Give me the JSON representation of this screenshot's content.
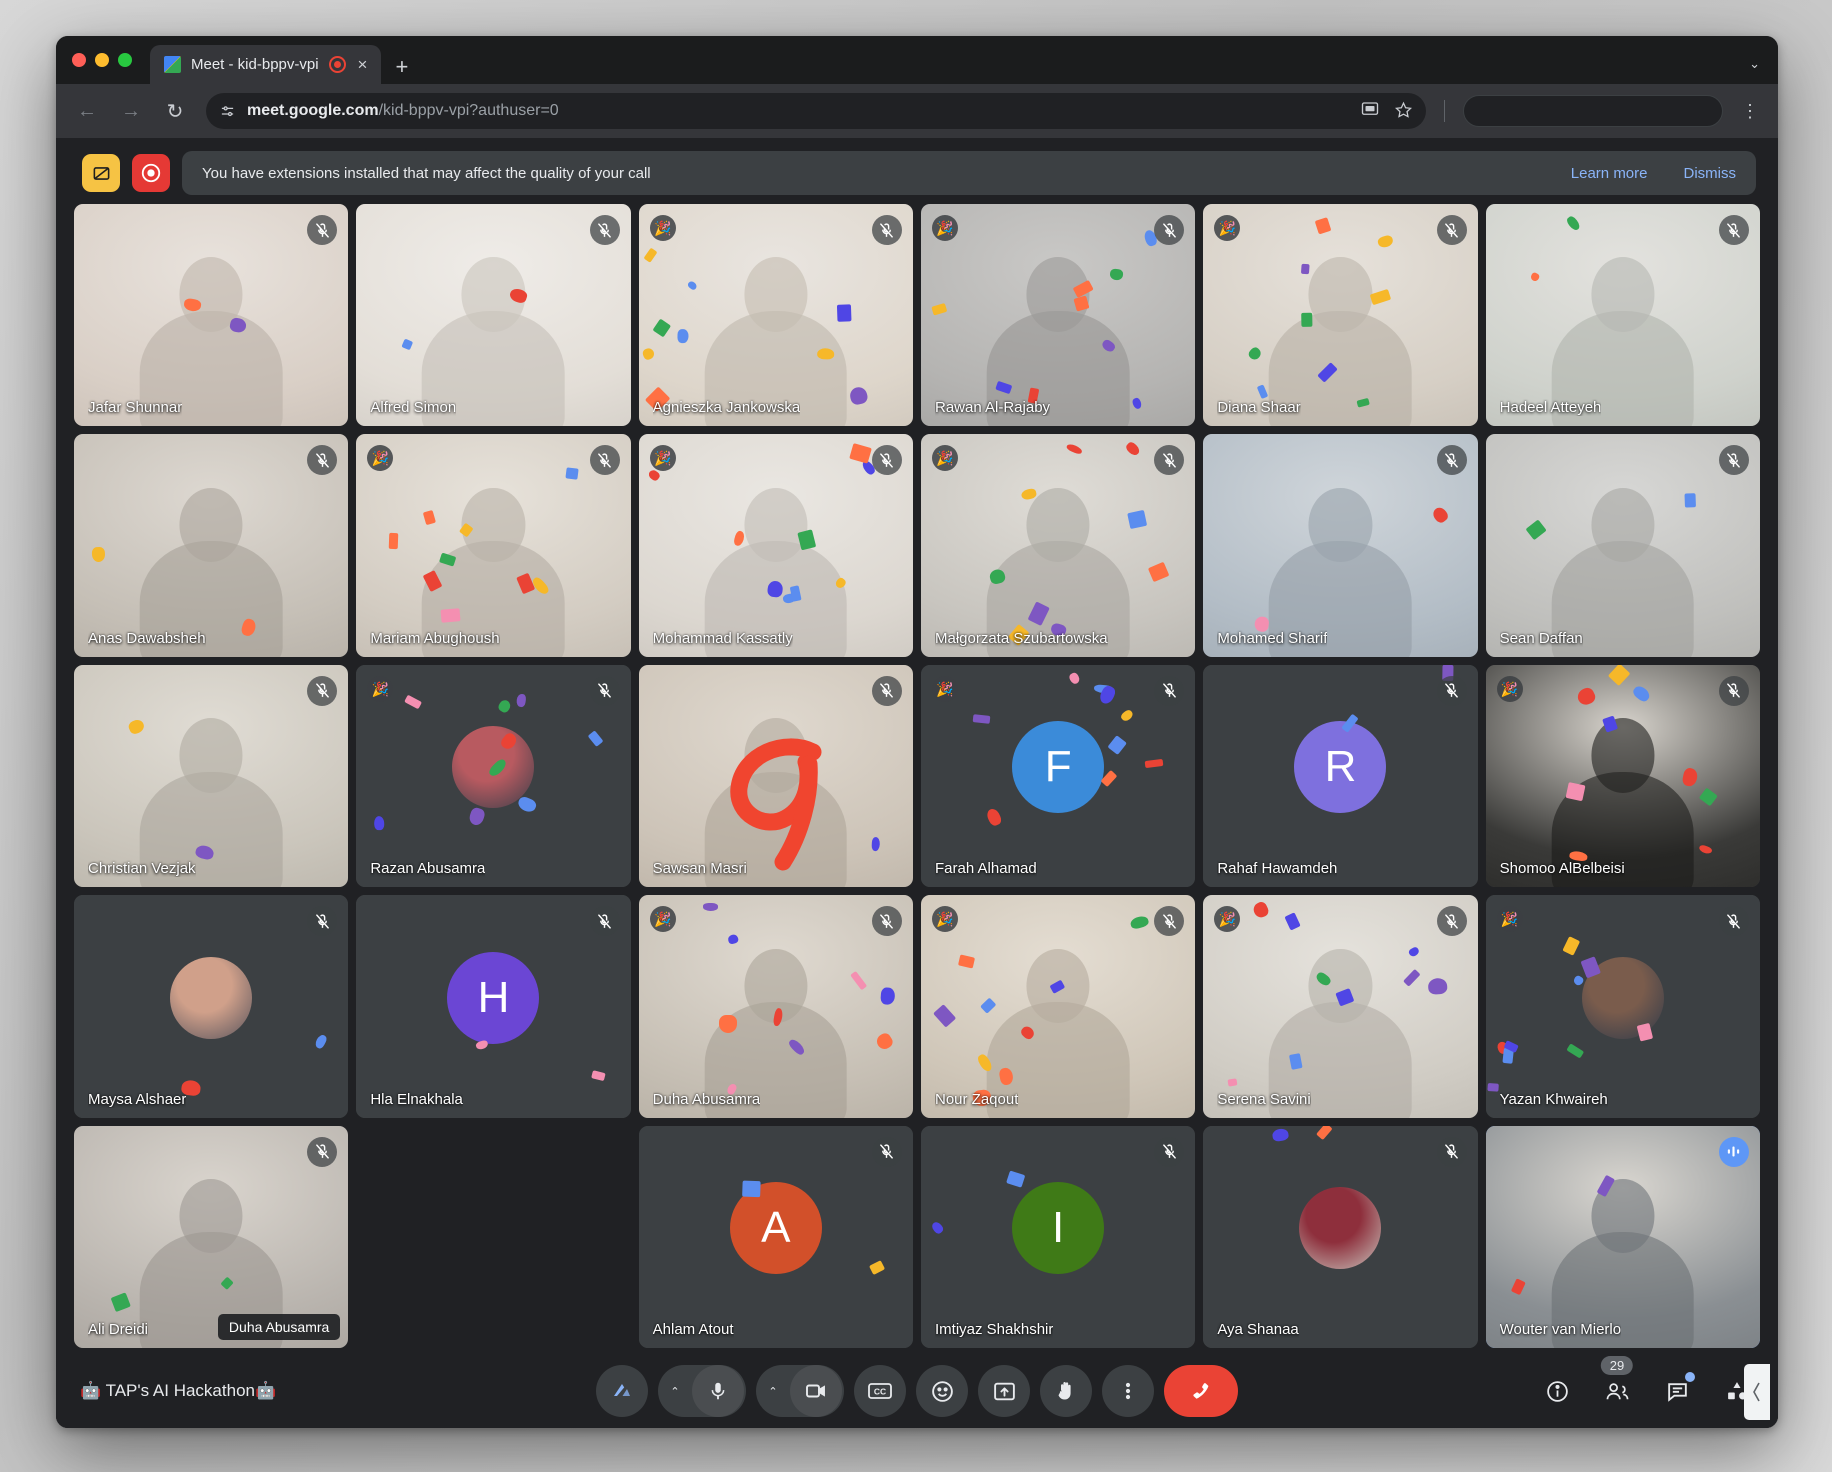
{
  "browser": {
    "tab": {
      "title": "Meet - kid-bppv-vpi",
      "favicon": "meet-favicon-icon",
      "recording_icon": "recording-indicator-icon",
      "close": "×"
    },
    "new_tab_label": "+",
    "window_chevron": "⌄",
    "nav": {
      "back": "←",
      "forward": "→",
      "reload": "↻"
    },
    "omnibox": {
      "site_settings_icon": "tune-icon",
      "domain": "meet.google.com",
      "path": "/kid-bppv-vpi?authuser=0",
      "cast_icon": "cast-icon",
      "bookmark_icon": "star-icon"
    },
    "menu_icon": "kebab-menu-icon"
  },
  "banner": {
    "extension_icons": [
      "blocked-extension-icon",
      "recorder-extension-icon"
    ],
    "message": "You have extensions installed that may affect the quality of your call",
    "learn_more": "Learn more",
    "dismiss": "Dismiss"
  },
  "meeting": {
    "title": "🤖 TAP's AI Hackathon🤖",
    "participant_count": "29"
  },
  "toolbar": {
    "left_buttons": [
      {
        "name": "host-tools-button",
        "icon": "host-controls-icon"
      }
    ],
    "center_buttons": [
      {
        "name": "microphone-button",
        "icon": "microphone-icon",
        "has_caret": true,
        "caret": "⌃"
      },
      {
        "name": "camera-button",
        "icon": "video-camera-icon",
        "has_caret": true,
        "caret": "⌃"
      },
      {
        "name": "captions-button",
        "icon": "closed-captions-icon",
        "label": "CC"
      },
      {
        "name": "reactions-button",
        "icon": "emoji-smiley-icon"
      },
      {
        "name": "present-now-button",
        "icon": "present-screen-icon"
      },
      {
        "name": "raise-hand-button",
        "icon": "raised-hand-icon"
      },
      {
        "name": "more-options-button",
        "icon": "kebab-menu-icon"
      },
      {
        "name": "leave-call-button",
        "icon": "end-call-phone-icon"
      }
    ],
    "right_buttons": [
      {
        "name": "meeting-details-button",
        "icon": "info-circle-icon",
        "badge": ""
      },
      {
        "name": "people-button",
        "icon": "people-icon",
        "badge": "29"
      },
      {
        "name": "chat-button",
        "icon": "chat-bubble-icon",
        "badge": "",
        "has_dot": true
      },
      {
        "name": "activities-button",
        "icon": "activities-shapes-icon",
        "badge": ""
      }
    ]
  },
  "tiles": [
    [
      {
        "name": "Jafar Shunnar",
        "kind": "video",
        "muted": true,
        "reaction": false,
        "bg": "video-jafar",
        "tones": [
          "#e8e2dc",
          "#d9cfc6"
        ]
      },
      {
        "name": "Alfred Simon",
        "kind": "video",
        "muted": true,
        "reaction": false,
        "bg": "video-alfred",
        "tones": [
          "#efece8",
          "#e3ded7"
        ]
      },
      {
        "name": "Agnieszka Jankowska",
        "kind": "video",
        "muted": true,
        "reaction": true,
        "bg": "video-agnieszka",
        "tones": [
          "#e9e5e0",
          "#ded6cb"
        ]
      },
      {
        "name": "Rawan Al-Rajaby",
        "kind": "video",
        "muted": true,
        "reaction": true,
        "bg": "video-rawan",
        "tones": [
          "#c9c8c6",
          "#b5b4b2"
        ]
      },
      {
        "name": "Diana Shaar",
        "kind": "video",
        "muted": true,
        "reaction": true,
        "bg": "video-diana",
        "tones": [
          "#e6e1da",
          "#d6cfc5"
        ]
      },
      {
        "name": "Hadeel Atteyeh",
        "kind": "video",
        "muted": true,
        "reaction": false,
        "bg": "video-hadeel",
        "tones": [
          "#e3e2de",
          "#cfd2cc"
        ]
      }
    ],
    [
      {
        "name": "Anas Dawabsheh",
        "kind": "video",
        "muted": true,
        "reaction": false,
        "bg": "video-anas",
        "tones": [
          "#ddd8d1",
          "#c5bfb6"
        ]
      },
      {
        "name": "Mariam Abughoush",
        "kind": "video",
        "muted": true,
        "reaction": true,
        "bg": "video-mariam",
        "tones": [
          "#e7e2da",
          "#d3ccc2"
        ]
      },
      {
        "name": "Mohammad Kassatly",
        "kind": "video",
        "muted": true,
        "reaction": true,
        "bg": "video-mohammad",
        "tones": [
          "#eae7e2",
          "#dcd7d0"
        ]
      },
      {
        "name": "Małgorzata Szubartowska",
        "kind": "video",
        "muted": true,
        "reaction": true,
        "bg": "video-malgorzata",
        "tones": [
          "#dfdcd6",
          "#c8c5bf"
        ]
      },
      {
        "name": "Mohamed Sharif",
        "kind": "video",
        "muted": true,
        "reaction": false,
        "bg": "video-mohamedsharif",
        "tones": [
          "#cfd5da",
          "#b3bdc6"
        ]
      },
      {
        "name": "Sean Daffan",
        "kind": "video",
        "muted": true,
        "reaction": false,
        "bg": "video-sean",
        "tones": [
          "#d7d7d5",
          "#c0c0bd"
        ]
      }
    ],
    [
      {
        "name": "Christian Vezjak",
        "kind": "video",
        "muted": true,
        "reaction": false,
        "bg": "video-christian",
        "tones": [
          "#e0dcd4",
          "#cac5bb"
        ]
      },
      {
        "name": "Razan Abusamra",
        "kind": "avatar-photo",
        "muted": true,
        "reaction": true,
        "photo_tones": [
          "#b85a60",
          "#3a3f4a"
        ]
      },
      {
        "name": "Sawsan Masri",
        "kind": "video",
        "muted": true,
        "reaction": false,
        "bg": "video-sawsan",
        "tones": [
          "#dfd8ce",
          "#cdc4b8"
        ]
      },
      {
        "name": "Farah Alhamad",
        "kind": "avatar-initial",
        "initial": "F",
        "color": "#3b8bd9",
        "muted": true,
        "reaction": true
      },
      {
        "name": "Rahaf Hawamdeh",
        "kind": "avatar-initial",
        "initial": "R",
        "color": "#7e70de",
        "muted": true,
        "reaction": false
      },
      {
        "name": "Shomoo AlBelbeisi",
        "kind": "video",
        "muted": true,
        "reaction": true,
        "bg": "video-shomoo",
        "tones": [
          "#d8d4cd",
          "#3a3a38"
        ]
      }
    ],
    [
      {
        "name": "Maysa Alshaer",
        "kind": "avatar-photo",
        "muted": true,
        "reaction": false,
        "photo_tones": [
          "#d0a08a",
          "#57535c"
        ]
      },
      {
        "name": "Hla Elnakhala",
        "kind": "avatar-initial",
        "initial": "H",
        "color": "#6b46d4",
        "muted": true,
        "reaction": false
      },
      {
        "name": "Duha Abusamra",
        "kind": "video",
        "muted": true,
        "reaction": true,
        "bg": "video-duha",
        "tones": [
          "#dfd9d0",
          "#c6bfb4"
        ]
      },
      {
        "name": "Nour Zaqout",
        "kind": "video",
        "muted": true,
        "reaction": true,
        "bg": "video-nour",
        "tones": [
          "#e4ddd2",
          "#cfc6b8"
        ]
      },
      {
        "name": "Serena Savini",
        "kind": "video",
        "muted": true,
        "reaction": true,
        "bg": "video-serena",
        "tones": [
          "#e5e2dc",
          "#d0ccc4"
        ]
      },
      {
        "name": "Yazan Khwaireh",
        "kind": "avatar-photo",
        "muted": true,
        "reaction": true,
        "photo_tones": [
          "#7a5c4c",
          "#2f3a4a"
        ]
      }
    ],
    [
      {
        "name": "Ali Dreidi",
        "kind": "video",
        "muted": true,
        "reaction": false,
        "bg": "video-ali",
        "tones": [
          "#d9d4cd",
          "#b9b4ae"
        ],
        "pinned_label": "Duha Abusamra"
      },
      {
        "name": "Ahlam Atout",
        "kind": "avatar-initial",
        "initial": "A",
        "color": "#d2502a",
        "muted": true,
        "reaction": false
      },
      {
        "name": "Imtiyaz Shakhshir",
        "kind": "avatar-initial",
        "initial": "I",
        "color": "#3f7a17",
        "muted": true,
        "reaction": false
      },
      {
        "name": "Aya Shanaa",
        "kind": "avatar-photo",
        "muted": true,
        "reaction": false,
        "photo_tones": [
          "#8e2f3c",
          "#c8c4bd"
        ]
      },
      {
        "name": "Wouter van Mierlo",
        "kind": "video",
        "muted": false,
        "self": true,
        "reaction": false,
        "bg": "video-wouter",
        "tones": [
          "#d9d6d0",
          "#8a8f93"
        ]
      }
    ]
  ]
}
